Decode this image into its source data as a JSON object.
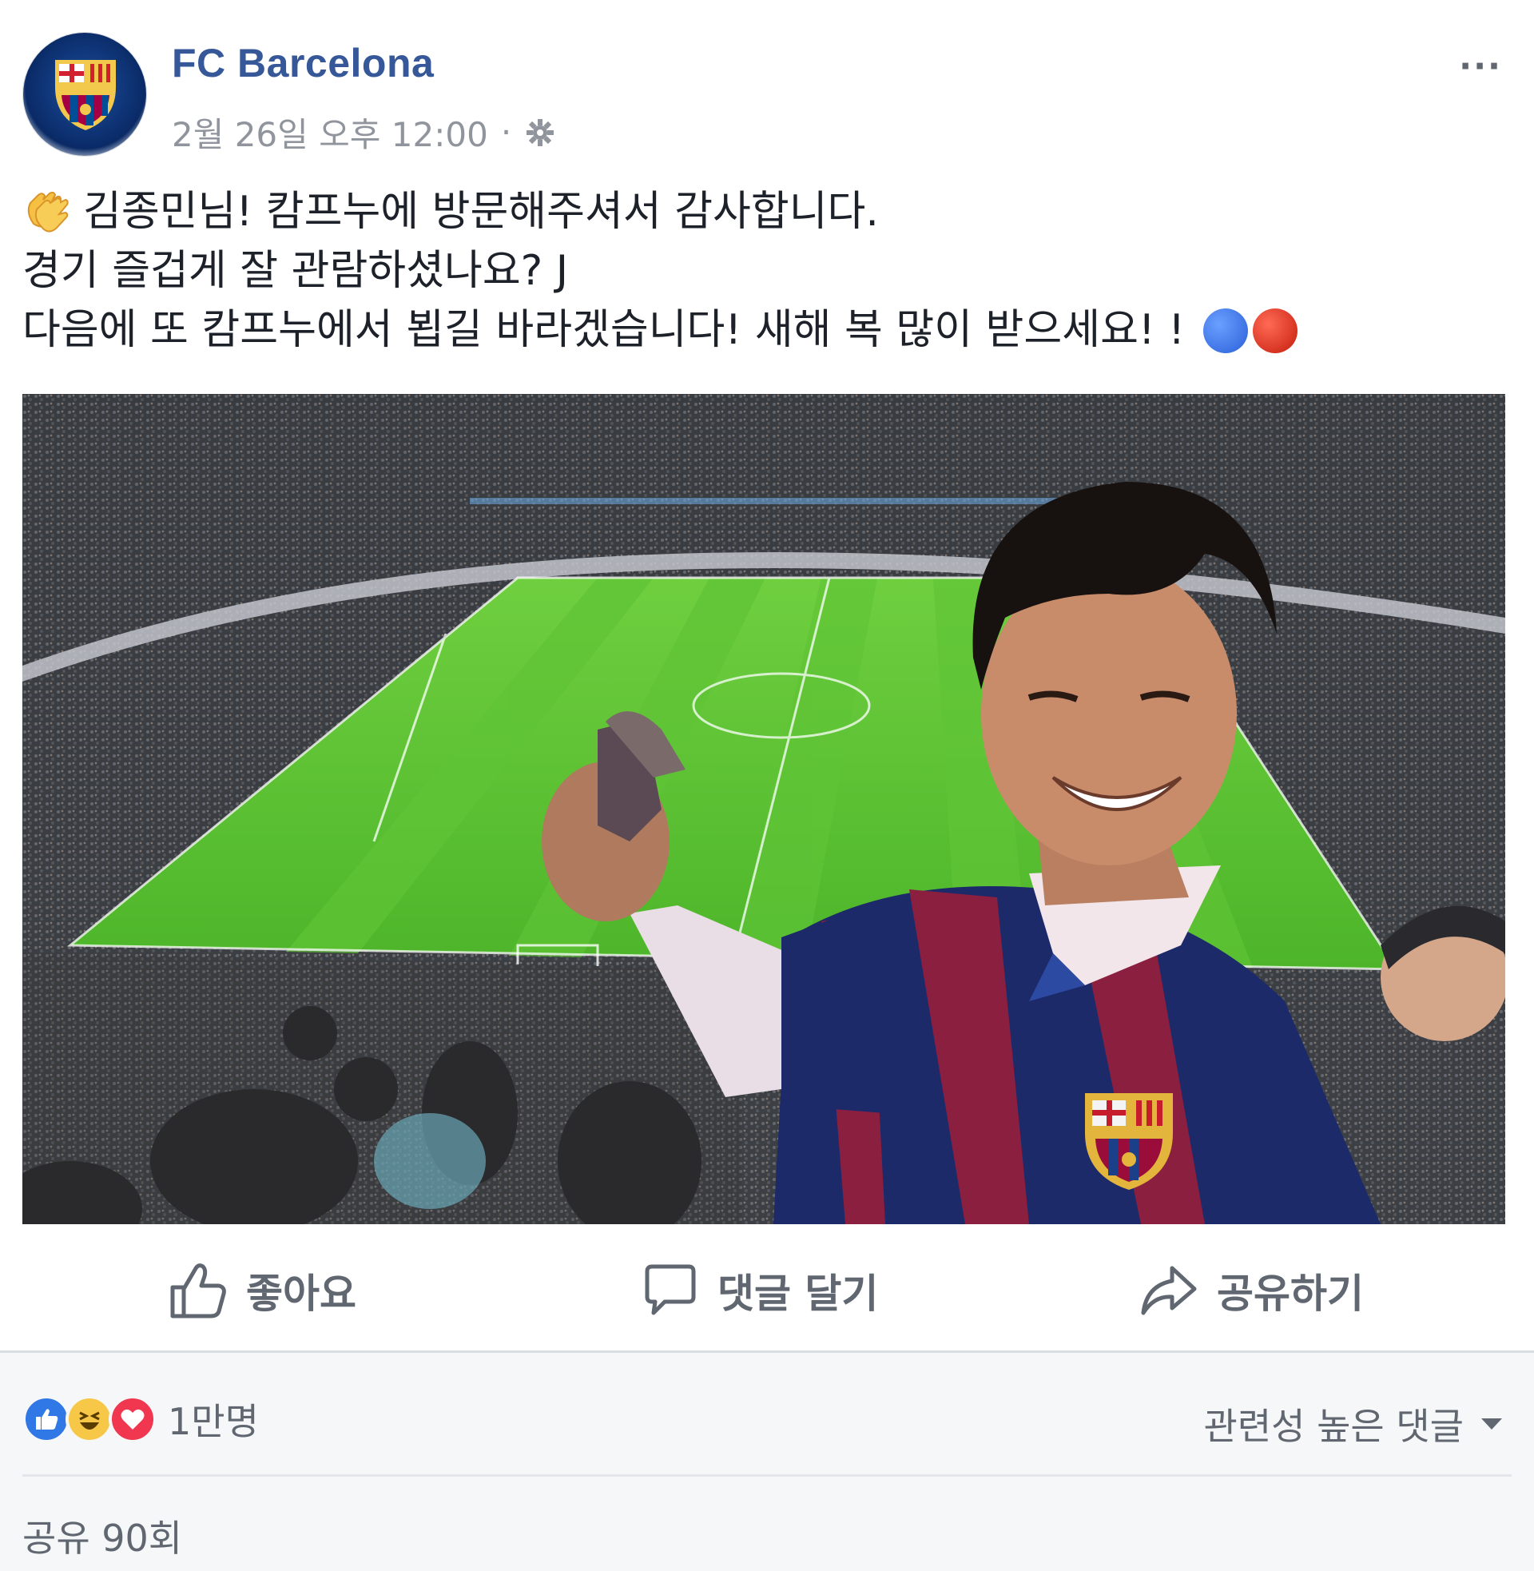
{
  "header": {
    "page_name": "FC Barcelona",
    "timestamp": "2월 26일 오후 12:00",
    "separator": "·",
    "more_label": "···"
  },
  "post": {
    "line1": "김종민님! 캄프누에 방문해주셔서 감사합니다.",
    "line2": "경기 즐겁게 잘 관람하셨나요? J",
    "line3": "다음에 또 캄프누에서 뵙길 바라겠습니다! 새해 복 많이 받으세요! !",
    "icons": [
      "clapping-hands-icon",
      "blue-circle-icon",
      "red-circle-icon"
    ]
  },
  "actions": {
    "like_label": "좋아요",
    "comment_label": "댓글 달기",
    "share_label": "공유하기"
  },
  "footer": {
    "reaction_icons": [
      "like-icon",
      "haha-icon",
      "love-icon"
    ],
    "reaction_count": "1만명",
    "sort_label": "관련성 높은 댓글",
    "shares_label": "공유 90회"
  },
  "colors": {
    "page_name": "#365899",
    "meta_text": "#90949c",
    "action_text": "#606770",
    "footer_bg": "#f6f7f9",
    "like": "#2f78e6",
    "love": "#f0374f",
    "haha": "#f7c748"
  }
}
